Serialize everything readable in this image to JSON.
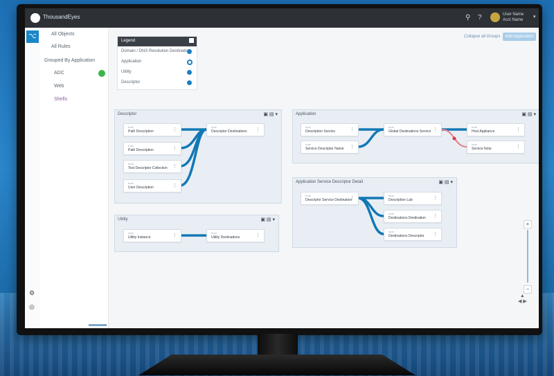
{
  "app": {
    "title": "ThousandEyes",
    "user_name": "User Name",
    "user_account": "Acct Name",
    "icon_search": "search-icon",
    "icon_help": "help-icon"
  },
  "sidebar": {
    "items": [
      {
        "label": "All Objects"
      },
      {
        "label": "All Rules"
      },
      {
        "label": "Grouped By Application"
      },
      {
        "label": "ADC",
        "badge": "green"
      },
      {
        "label": "Web"
      },
      {
        "label": "Shells"
      }
    ]
  },
  "legend": {
    "title": "Legend",
    "rows": [
      {
        "label": "Domain / DNS Resolution Destination"
      },
      {
        "label": "Application"
      },
      {
        "label": "Utility"
      },
      {
        "label": "Descriptor"
      }
    ]
  },
  "toolbar": {
    "link_label": "Collapse all Groups",
    "button_label": "Add Application"
  },
  "groups": [
    {
      "title": "Descriptor",
      "nodes": [
        {
          "type": "host",
          "name": "Path Description"
        },
        {
          "type": "host",
          "name": "Path Description"
        },
        {
          "type": "host",
          "name": "Test Descriptor Collection"
        },
        {
          "type": "host",
          "name": "User Description"
        },
        {
          "type": "host",
          "name": "Descriptor Destinations"
        }
      ]
    },
    {
      "title": "Utility",
      "nodes": [
        {
          "type": "host",
          "name": "Utility Instance"
        },
        {
          "type": "host",
          "name": "Utility Destinations"
        }
      ]
    },
    {
      "title": "Application",
      "nodes": [
        {
          "type": "host",
          "name": "Description Service"
        },
        {
          "type": "host",
          "name": "Service Descriptor Name"
        },
        {
          "type": "host",
          "name": "Global Destinations Service"
        },
        {
          "type": "host",
          "name": "Host Appliance"
        },
        {
          "type": "host",
          "name": "Service Note"
        }
      ]
    },
    {
      "title": "Application Service Descriptor Detail",
      "nodes": [
        {
          "type": "host",
          "name": "Descriptor Service Destination"
        },
        {
          "type": "host",
          "name": "Description Lab"
        },
        {
          "type": "host",
          "name": "Destinations Destination"
        },
        {
          "type": "host",
          "name": "Destinations Descriptor"
        }
      ]
    }
  ],
  "colors": {
    "edge": "#1278b4",
    "edge_alert": "#e57e85",
    "alert_dot": "#d73a49",
    "topbar": "#2d3136"
  }
}
